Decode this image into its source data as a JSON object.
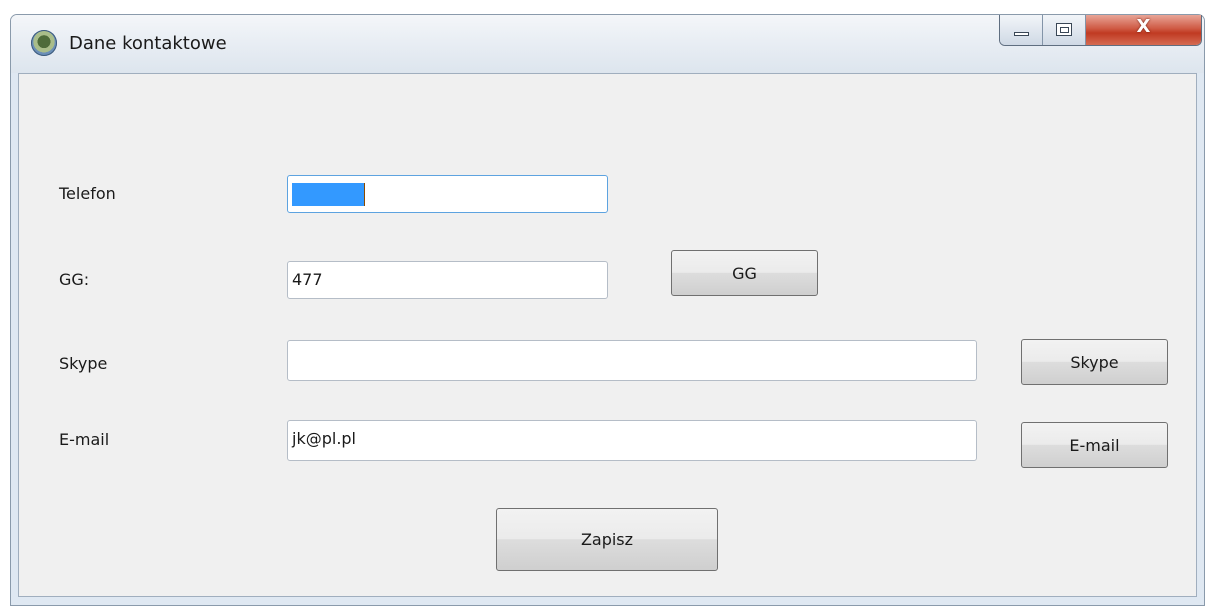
{
  "window": {
    "title": "Dane kontaktowe",
    "close_glyph": "X",
    "icon": "app-globe-icon"
  },
  "form": {
    "phone_label": "Telefon",
    "phone_value": "",
    "gg_label": "GG:",
    "gg_value": "477",
    "gg_button": "GG",
    "skype_label": "Skype",
    "skype_value": "",
    "skype_button": "Skype",
    "email_label": "E-mail",
    "email_value": "jk@pl.pl",
    "email_button": "E-mail",
    "save_button": "Zapisz"
  },
  "colors": {
    "selection": "#3399ff",
    "focus_border": "#5da3e0",
    "close_button": "#c03a22"
  }
}
